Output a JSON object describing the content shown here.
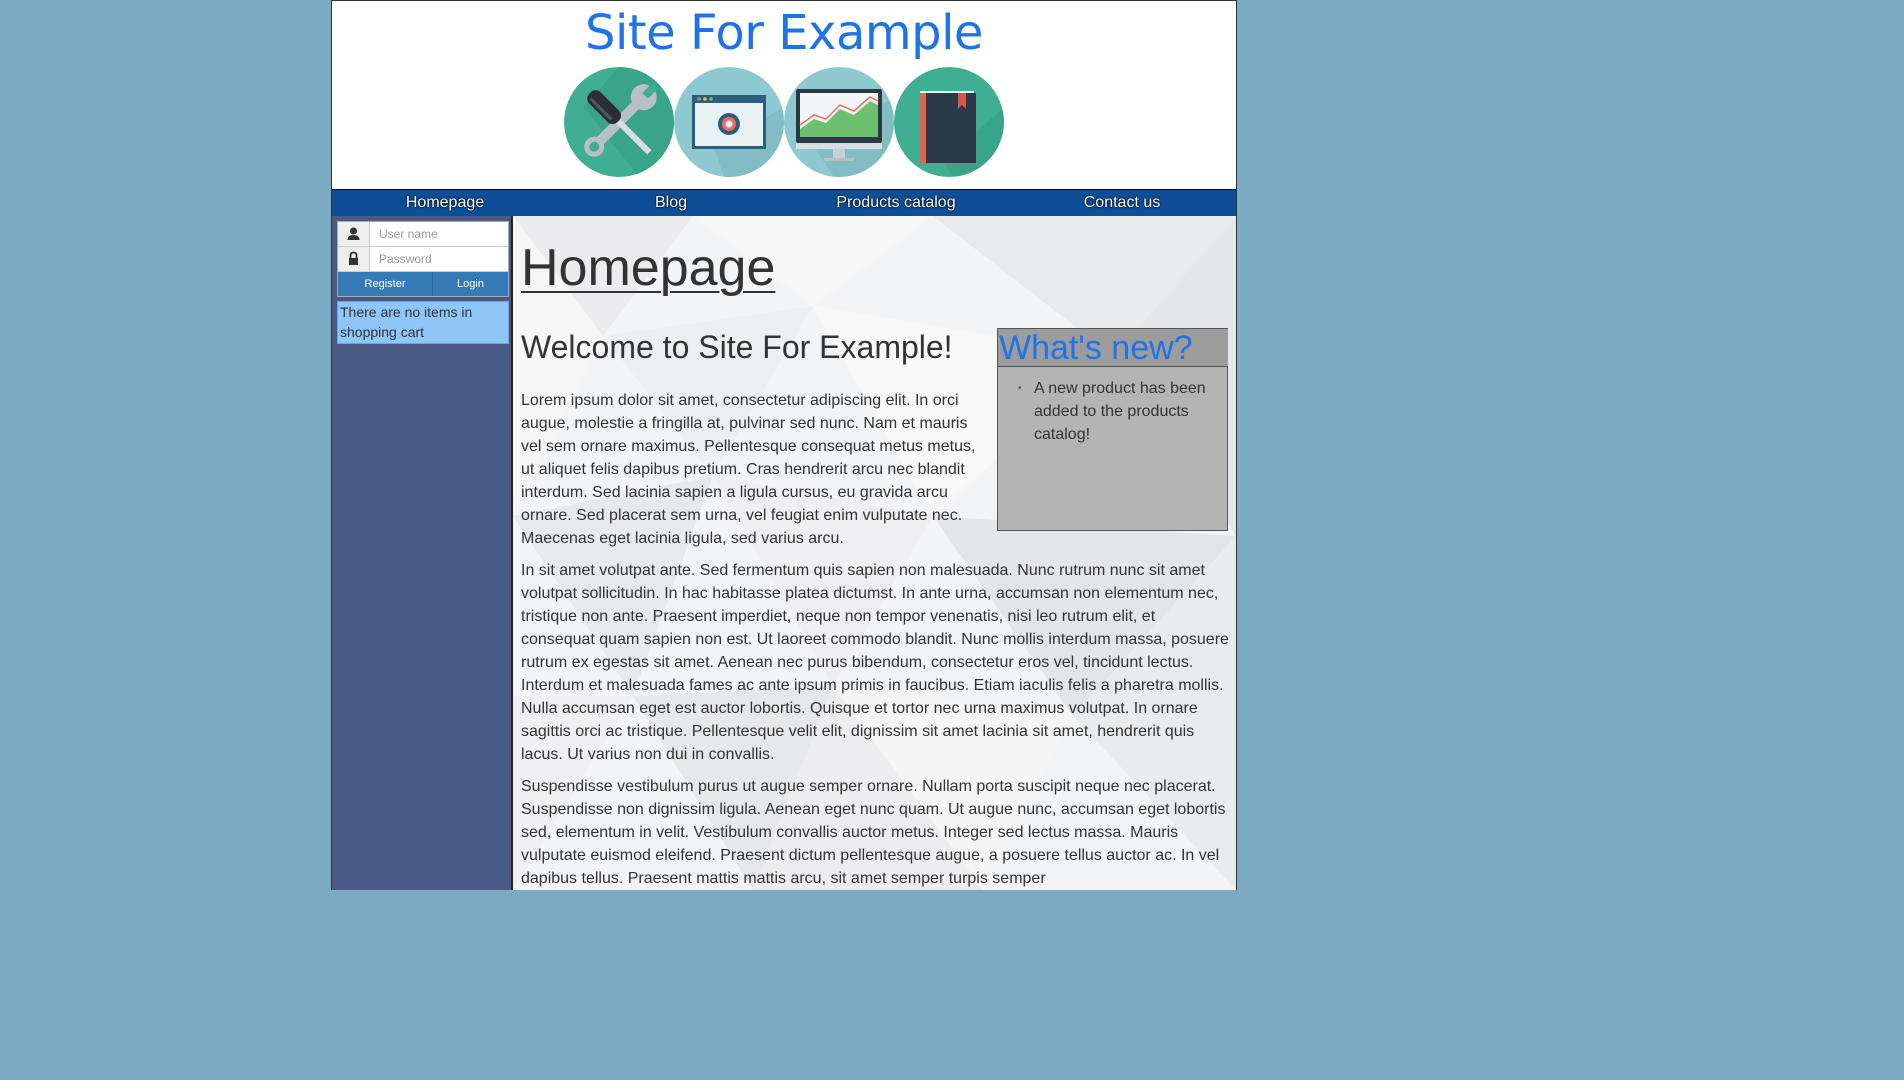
{
  "header": {
    "site_title": "Site For Example",
    "banner_icons": [
      "tools-icon",
      "settings-window-icon",
      "analytics-monitor-icon",
      "book-icon"
    ]
  },
  "nav": {
    "items": [
      {
        "label": "Homepage"
      },
      {
        "label": "Blog"
      },
      {
        "label": "Products catalog"
      },
      {
        "label": "Contact us"
      }
    ]
  },
  "sidebar": {
    "username_placeholder": "User name",
    "password_placeholder": "Password",
    "register_label": "Register",
    "login_label": "Login",
    "cart_text": "There are no items in shopping cart"
  },
  "main": {
    "page_title": "Homepage",
    "welcome": "Welcome to Site For Example!",
    "paragraphs": [
      "Lorem ipsum dolor sit amet, consectetur adipiscing elit. In orci augue, molestie a fringilla at, pulvinar sed nunc. Nam et mauris vel sem ornare maximus. Pellentesque consequat metus metus, ut aliquet felis dapibus pretium. Cras hendrerit arcu nec blandit interdum. Sed lacinia sapien a ligula cursus, eu gravida arcu ornare. Sed placerat sem urna, vel feugiat enim vulputate nec. Maecenas eget lacinia ligula, sed varius arcu.",
      "In sit amet volutpat ante. Sed fermentum quis sapien non malesuada. Nunc rutrum nunc sit amet volutpat sollicitudin. In hac habitasse platea dictumst. In ante urna, accumsan non elementum nec, tristique non ante. Praesent imperdiet, neque non tempor venenatis, nisi leo rutrum elit, et consequat quam sapien non est. Ut laoreet commodo blandit. Nunc mollis interdum massa, posuere rutrum ex egestas sit amet. Aenean nec purus bibendum, consectetur eros vel, tincidunt lectus. Interdum et malesuada fames ac ante ipsum primis in faucibus. Etiam iaculis felis a pharetra mollis. Nulla accumsan eget est auctor lobortis. Quisque et tortor nec urna maximus volutpat. In ornare sagittis orci ac tristique. Pellentesque velit elit, dignissim sit amet lacinia sit amet, hendrerit quis lacus. Ut varius non dui in convallis.",
      "Suspendisse vestibulum purus ut augue semper ornare. Nullam porta suscipit neque nec placerat. Suspendisse non dignissim ligula. Aenean eget nunc quam. Ut augue nunc, accumsan eget lobortis sed, elementum in velit. Vestibulum convallis auctor metus. Integer sed lectus massa. Mauris vulputate euismod eleifend. Praesent dictum pellentesque augue, a posuere tellus auctor ac. In vel dapibus tellus. Praesent mattis mattis arcu, sit amet semper turpis semper"
    ],
    "whats_new": {
      "title": "What's new?",
      "items": [
        "A new product has been added to the products catalog!"
      ]
    }
  },
  "colors": {
    "page_background": "#7aaac4",
    "nav_background": "#0e4e96",
    "sidebar_background": "#4a5a86",
    "title_blue": "#1e73e8",
    "cart_background": "#8ec6f7",
    "button_blue": "#337ab7"
  }
}
